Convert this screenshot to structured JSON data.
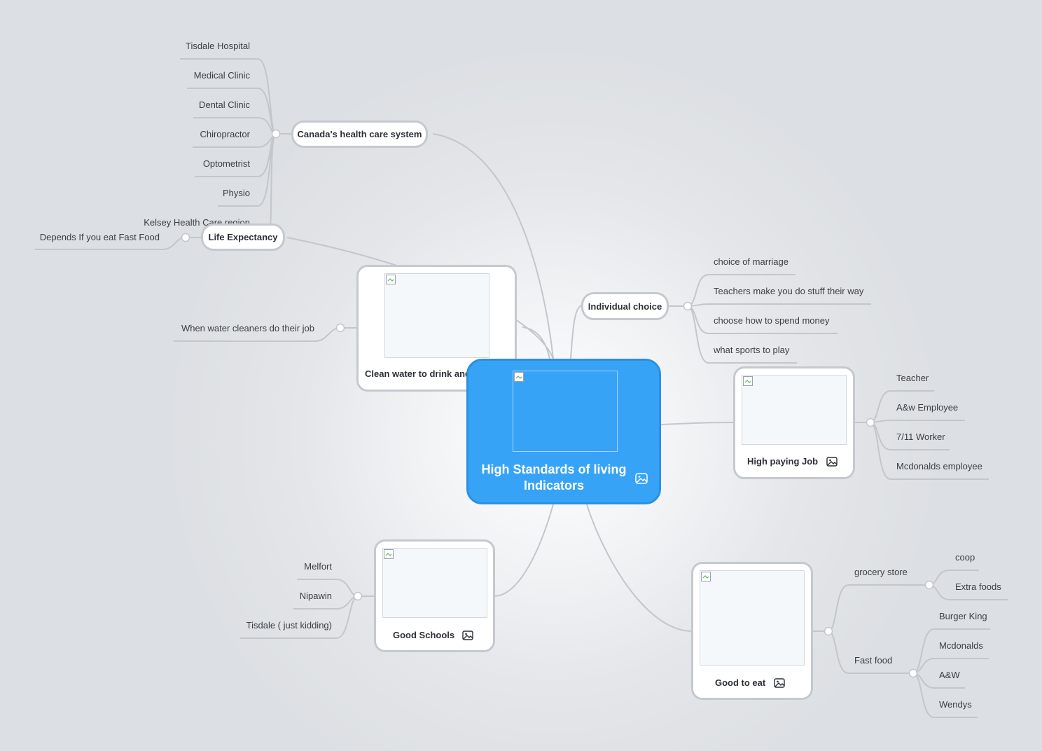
{
  "central": {
    "title": "High Standards of living Indicators",
    "icon": "image-icon",
    "color": "#36a3f7"
  },
  "branches": {
    "health": {
      "label": "Canada's health care system",
      "items": [
        "Tisdale Hospital",
        "Medical Clinic",
        "Dental Clinic",
        "Chiropractor",
        "Optometrist",
        "Physio",
        "Kelsey Health Care region"
      ]
    },
    "life": {
      "label": "Life Expectancy",
      "items": [
        "Depends If you eat Fast Food"
      ]
    },
    "water": {
      "label": "Clean water to drink and use",
      "items": [
        "When water cleaners do their job"
      ]
    },
    "choice": {
      "label": "Individual choice",
      "items": [
        "choice of marriage",
        "Teachers make you do stuff their way",
        "choose how to spend money",
        "what sports to play"
      ]
    },
    "job": {
      "label": "High paying Job",
      "items": [
        "Teacher",
        "A&w Employee",
        "7/11 Worker",
        "Mcdonalds employee"
      ]
    },
    "schools": {
      "label": "Good Schools",
      "items": [
        "Melfort",
        "Nipawin",
        "Tisdale ( just kidding)"
      ]
    },
    "eat": {
      "label": "Good to eat",
      "grocery": {
        "label": "grocery store",
        "items": [
          "coop",
          "Extra foods"
        ]
      },
      "fastfood": {
        "label": "Fast food",
        "items": [
          "Burger King",
          "Mcdonalds",
          "A&W",
          "Wendys"
        ]
      }
    }
  }
}
